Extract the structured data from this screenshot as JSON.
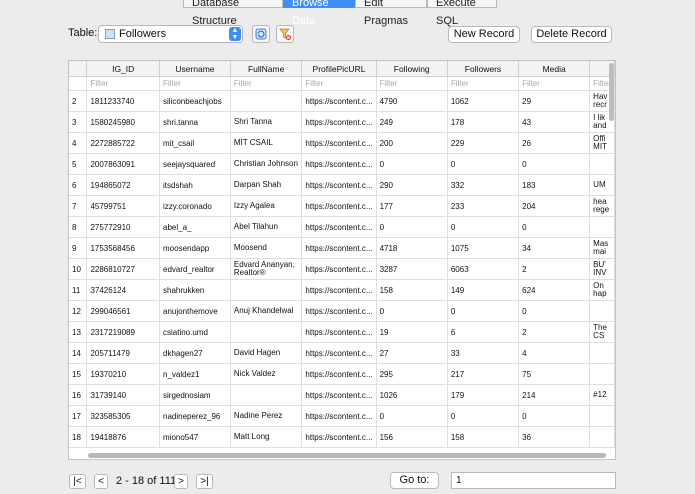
{
  "tabs": [
    {
      "label": "Database Structure",
      "active": false
    },
    {
      "label": "Browse Data",
      "active": true
    },
    {
      "label": "Edit Pragmas",
      "active": false
    },
    {
      "label": "Execute SQL",
      "active": false
    }
  ],
  "toolbar": {
    "table_label": "Table:",
    "table_name": "Followers",
    "new_record": "New Record",
    "delete_record": "Delete Record"
  },
  "grid": {
    "columns": [
      "",
      "IG_ID",
      "Username",
      "FullName",
      "ProfilePicURL",
      "Following",
      "Followers",
      "Media",
      ""
    ],
    "filter_placeholder": "Filter",
    "rows": [
      [
        "2",
        "1811233740",
        "siliconbeachjobs",
        "",
        "https://scontent.c...",
        "4790",
        "1062",
        "29",
        "Hav recr"
      ],
      [
        "3",
        "1580245980",
        "shri.tanna",
        "Shri Tanna",
        "https://scontent.c...",
        "249",
        "178",
        "43",
        "I lik and"
      ],
      [
        "4",
        "2272885722",
        "mit_csail",
        "MIT CSAIL",
        "https://scontent.c...",
        "200",
        "229",
        "26",
        "Offi MIT"
      ],
      [
        "5",
        "2007863091",
        "seejaysquared",
        "Christian Johnson",
        "https://scontent.c...",
        "0",
        "0",
        "0",
        ""
      ],
      [
        "6",
        "194865072",
        "itsdshah",
        "Darpan Shah",
        "https://scontent.c...",
        "290",
        "332",
        "183",
        "UM"
      ],
      [
        "7",
        "45799751",
        "izzy.coronado",
        "Izzy Agalea",
        "https://scontent.c...",
        "177",
        "233",
        "204",
        "hea rege"
      ],
      [
        "8",
        "275772910",
        "abel_a_",
        "Abel Tilahun",
        "https://scontent.c...",
        "0",
        "0",
        "0",
        ""
      ],
      [
        "9",
        "1753568456",
        "moosendapp",
        "Moosend",
        "https://scontent.c...",
        "4718",
        "1075",
        "34",
        "Mas mai"
      ],
      [
        "10",
        "2286810727",
        "edvard_realtor",
        "Edvard Ananyan, Realtor®",
        "https://scontent.c...",
        "3287",
        "6063",
        "2",
        "BU' INV"
      ],
      [
        "11",
        "37426124",
        "shahrukken",
        "",
        "https://scontent.c...",
        "158",
        "149",
        "624",
        "On hap"
      ],
      [
        "12",
        "299046561",
        "anujonthemove",
        "Anuj Khandelwal",
        "https://scontent.c...",
        "0",
        "0",
        "0",
        ""
      ],
      [
        "13",
        "2317219089",
        "csiatino.umd",
        "",
        "https://scontent.c...",
        "19",
        "6",
        "2",
        "The CS"
      ],
      [
        "14",
        "205711479",
        "dkhagen27",
        "David Hagen",
        "https://scontent.c...",
        "27",
        "33",
        "4",
        ""
      ],
      [
        "15",
        "19370210",
        "n_valdez1",
        "Nick Valdez",
        "https://scontent.c...",
        "295",
        "217",
        "75",
        ""
      ],
      [
        "16",
        "31739140",
        "sirgednosiam",
        "",
        "https://scontent.c...",
        "1026",
        "179",
        "214",
        "#12"
      ],
      [
        "17",
        "323585305",
        "nadineperez_96",
        "Nadine Perez",
        "https://scontent.c...",
        "0",
        "0",
        "0",
        ""
      ],
      [
        "18",
        "19418876",
        "miono547",
        "Matt Long",
        "https://scontent.c...",
        "156",
        "158",
        "36",
        ""
      ]
    ]
  },
  "pager": {
    "first": "|<",
    "prev": "<",
    "status": "2 - 18 of 111",
    "next": ">",
    "last": ">|",
    "goto_label": "Go to:",
    "goto_value": "1"
  }
}
